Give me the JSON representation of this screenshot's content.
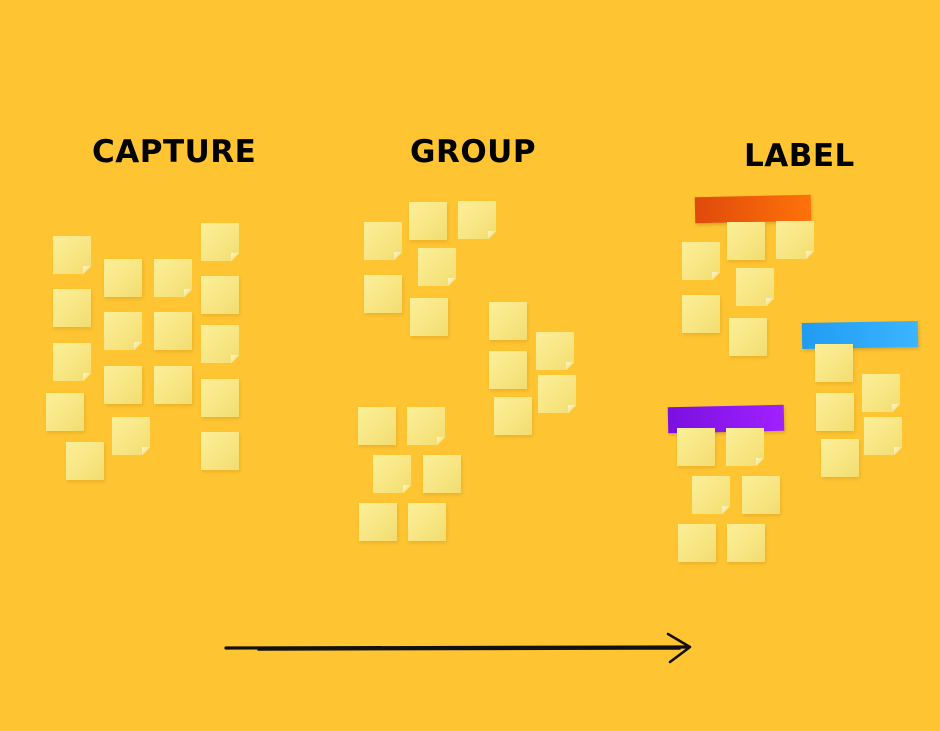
{
  "headings": {
    "capture": "CAPTURE",
    "group": "GROUP",
    "label": "LABEL"
  },
  "label_tapes": [
    {
      "name": "orange",
      "color": "#ff6a0b"
    },
    {
      "name": "blue",
      "color": "#2aa9ff"
    },
    {
      "name": "purple",
      "color": "#8d19ff"
    }
  ],
  "sticky_note_color": "#f9ea8c",
  "background_color": "#fec431"
}
